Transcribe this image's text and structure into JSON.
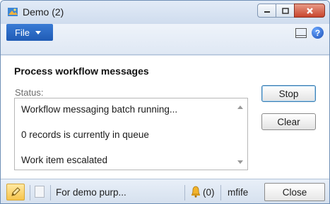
{
  "window": {
    "title": "Demo (2)"
  },
  "menu": {
    "file_label": "File"
  },
  "page": {
    "title": "Process workflow messages",
    "status_label": "Status:",
    "status_lines": [
      "Workflow messaging batch running...",
      "0 records is currently in queue",
      "Work item escalated"
    ]
  },
  "buttons": {
    "stop_label": "Stop",
    "clear_label": "Clear"
  },
  "statusbar": {
    "company_text": "For demo purp...",
    "notifications_text": "(0)",
    "user_text": "mfife",
    "close_label": "Close"
  },
  "icons": {
    "app": "app-icon",
    "minimize": "minimize-icon",
    "maximize": "maximize-icon",
    "close": "close-icon",
    "layout": "layout-icon",
    "help": "help-icon",
    "edit": "pencil-icon",
    "attachment": "document-icon",
    "notifications": "bell-icon"
  },
  "colors": {
    "file_tab": "#1f5bb5",
    "close_window_button": "#c9452d",
    "edit_button": "#f7c54d"
  }
}
